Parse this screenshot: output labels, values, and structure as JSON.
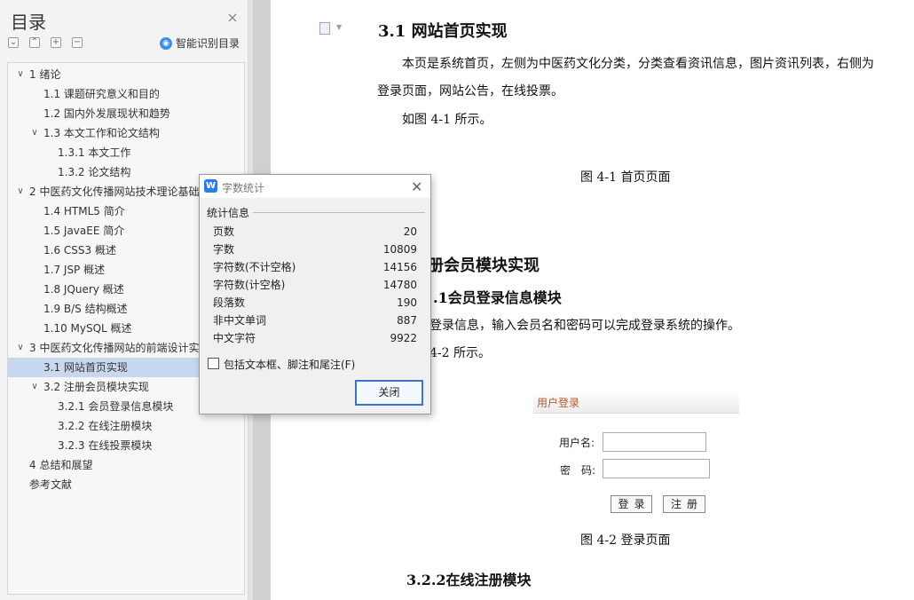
{
  "toc": {
    "title": "目录",
    "close_glyph": "×",
    "smart_toc_label": "智能识别目录",
    "items": [
      {
        "label": "1  绪论",
        "has_arrow": true
      },
      {
        "label": "1.1  课题研究意义和目的"
      },
      {
        "label": "1.2  国内外发展现状和趋势"
      },
      {
        "label": "1.3  本文工作和论文结构",
        "has_arrow": true
      },
      {
        "label": "1.3.1  本文工作"
      },
      {
        "label": "1.3.2  论文结构"
      },
      {
        "label": "2  中医药文化传播网站技术理论基础",
        "has_arrow": true
      },
      {
        "label": "1.4  HTML5 简介"
      },
      {
        "label": "1.5  JavaEE 简介"
      },
      {
        "label": "1.6  CSS3 概述"
      },
      {
        "label": "1.7  JSP 概述"
      },
      {
        "label": "1.8  JQuery 概述"
      },
      {
        "label": "1.9  B/S 结构概述"
      },
      {
        "label": "1.10  MySQL 概述"
      },
      {
        "label": "3  中医药文化传播网站的前端设计实现",
        "has_arrow": true
      },
      {
        "label": "3.1  网站首页实现",
        "active": true
      },
      {
        "label": "3.2  注册会员模块实现",
        "has_arrow": true
      },
      {
        "label": "3.2.1 会员登录信息模块"
      },
      {
        "label": "3.2.2 在线注册模块"
      },
      {
        "label": "3.2.3  在线投票模块"
      },
      {
        "label": "4  总结和展望"
      },
      {
        "label": "参考文献"
      }
    ]
  },
  "document": {
    "heading_31": "3.1 网站首页实现",
    "para_1_line1": "本页是系统首页，左侧为中医药文化分类，分类查看资讯信息，图片资讯列表，右侧为",
    "para_1_line2": "登录页面，网站公告，在线投票。",
    "para_2": "如图 4-1 所示。",
    "caption_1": "图 4-1 首页页面",
    "heading_32_partial": "册会员模块实现",
    "heading_321_partial": ".1会员登录信息模块",
    "para_3_partial": "登录信息，输入会员名和密码可以完成登录系统的操作。",
    "para_4_partial": "4-2 所示。",
    "login_box": {
      "header": "用户登录",
      "username_label": "用户名:",
      "password_label": "密　码:",
      "login_button": "登录",
      "register_button": "注册"
    },
    "caption_2": "图 4-2 登录页面",
    "heading_322": "3.2.2在线注册模块"
  },
  "dialog": {
    "title": "字数统计",
    "section_label": "统计信息",
    "stats": [
      {
        "label": "页数",
        "value": "20"
      },
      {
        "label": "字数",
        "value": "10809"
      },
      {
        "label": "字符数(不计空格)",
        "value": "14156"
      },
      {
        "label": "字符数(计空格)",
        "value": "14780"
      },
      {
        "label": "段落数",
        "value": "190"
      },
      {
        "label": "非中文单词",
        "value": "887"
      },
      {
        "label": "中文字符",
        "value": "9922"
      }
    ],
    "include_checkbox_label": "包括文本框、脚注和尾注(F)",
    "include_checked": false,
    "close_button": "关闭"
  }
}
